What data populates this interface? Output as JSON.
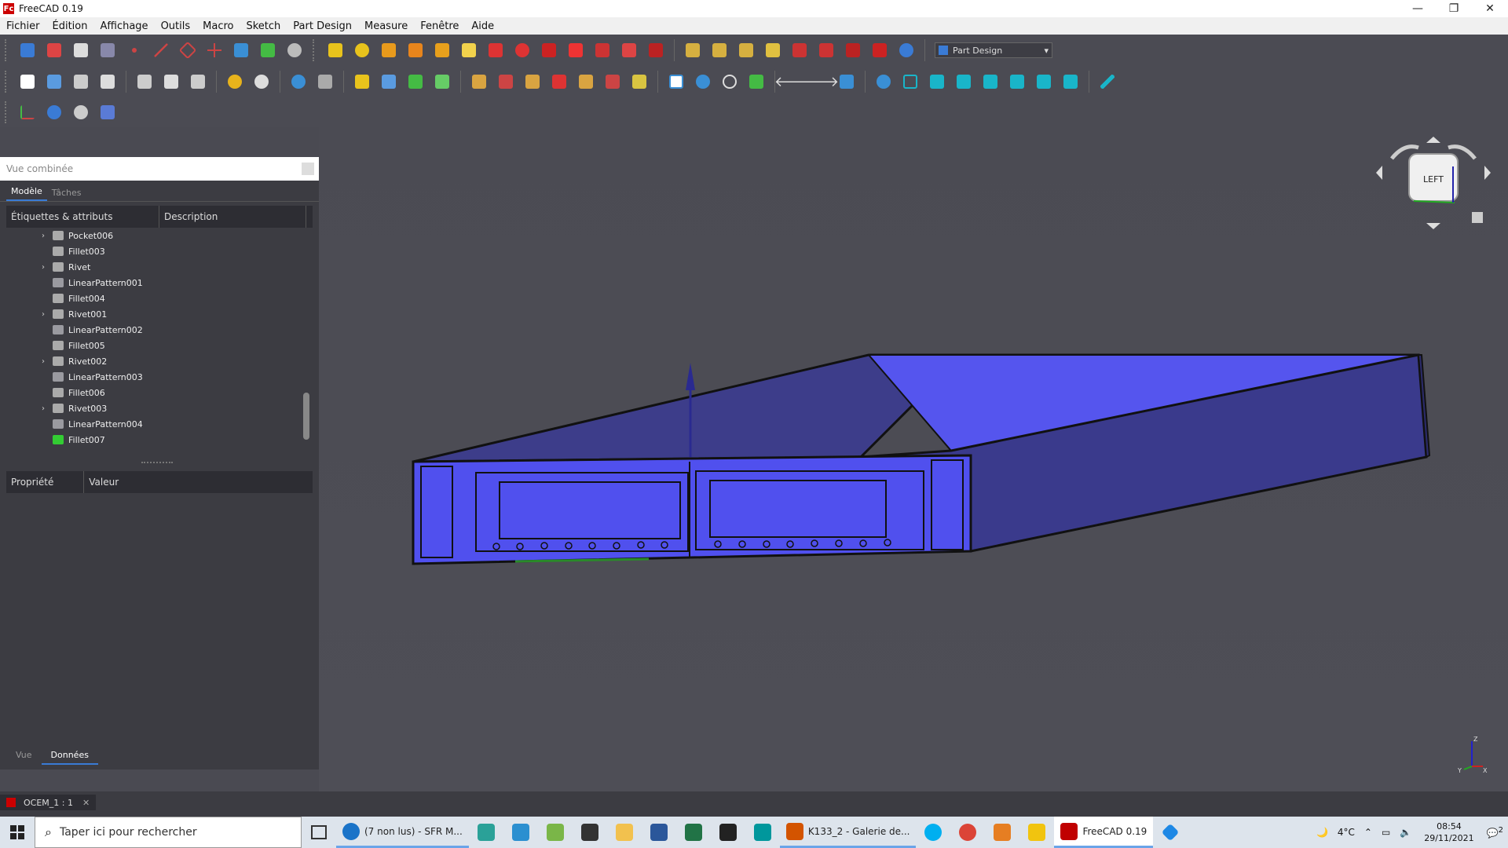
{
  "window": {
    "title": "FreeCAD 0.19",
    "logo_letters": "Fc"
  },
  "menu": [
    "Fichier",
    "Édition",
    "Affichage",
    "Outils",
    "Macro",
    "Sketch",
    "Part Design",
    "Measure",
    "Fenêtre",
    "Aide"
  ],
  "workbench": {
    "selected": "Part Design"
  },
  "combo": {
    "title": "Vue combinée",
    "tabs": [
      "Modèle",
      "Tâches"
    ],
    "tree_headers": [
      "Étiquettes & attributs",
      "Description"
    ],
    "tree_items": [
      {
        "label": "Pocket006",
        "expandable": true,
        "kind": "feature"
      },
      {
        "label": "Fillet003",
        "expandable": false,
        "kind": "feature"
      },
      {
        "label": "Rivet",
        "expandable": true,
        "kind": "feature"
      },
      {
        "label": "LinearPattern001",
        "expandable": false,
        "kind": "pattern"
      },
      {
        "label": "Fillet004",
        "expandable": false,
        "kind": "feature"
      },
      {
        "label": "Rivet001",
        "expandable": true,
        "kind": "feature"
      },
      {
        "label": "LinearPattern002",
        "expandable": false,
        "kind": "pattern"
      },
      {
        "label": "Fillet005",
        "expandable": false,
        "kind": "feature"
      },
      {
        "label": "Rivet002",
        "expandable": true,
        "kind": "feature"
      },
      {
        "label": "LinearPattern003",
        "expandable": false,
        "kind": "pattern"
      },
      {
        "label": "Fillet006",
        "expandable": false,
        "kind": "feature"
      },
      {
        "label": "Rivet003",
        "expandable": true,
        "kind": "feature"
      },
      {
        "label": "LinearPattern004",
        "expandable": false,
        "kind": "pattern"
      },
      {
        "label": "Fillet007",
        "expandable": false,
        "kind": "tip"
      }
    ],
    "prop_headers": [
      "Propriété",
      "Valeur"
    ],
    "bottom_tabs": [
      "Vue",
      "Données"
    ]
  },
  "navcube": {
    "face": "LEFT"
  },
  "axis_labels": {
    "x": "X",
    "y": "Y",
    "z": "Z"
  },
  "document_tab": {
    "label": "OCEM_1 : 1"
  },
  "taskbar": {
    "search_placeholder": "Taper ici pour rechercher",
    "apps": [
      {
        "label": "(7 non lus) - SFR M...",
        "color": "#1a73c8",
        "state": "open"
      },
      {
        "label": "K133_2 - Galerie de...",
        "color": "#d35400",
        "state": "open"
      },
      {
        "label": "FreeCAD 0.19",
        "color": "#c00000",
        "state": "active"
      }
    ],
    "temperature": "4°C",
    "time": "08:54",
    "date": "29/11/2021",
    "notifications": "2"
  },
  "colors": {
    "accent": "#3a7bd5",
    "model_blue": "#5555ee",
    "background": "#4b4b53"
  }
}
